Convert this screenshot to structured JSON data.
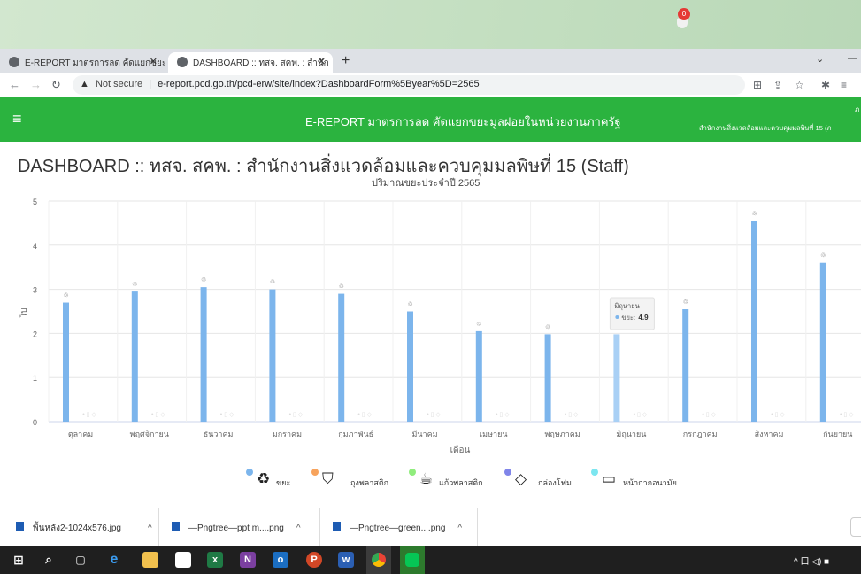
{
  "browser": {
    "tabs": [
      {
        "title": "E-REPORT มาตรการลด คัดแยกขยะมูล",
        "active": false
      },
      {
        "title": "DASHBOARD :: ทสจ. สคพ. : สำนัก",
        "active": true
      }
    ],
    "new_tab": "+",
    "security_label": "Not secure",
    "url": "e-report.pcd.go.th/pcd-erw/site/index?DashboardForm%5Byear%5D=2565"
  },
  "app": {
    "title": "E-REPORT มาตรการลด คัดแยกขยะมูลฝอยในหน่วยงานภาครัฐ",
    "notification_count": "0",
    "org_name": "สำนักงานสิ่งแวดล้อมและควบคุมมลพิษที่ 15 (ภ",
    "org_top": "ภ"
  },
  "page": {
    "title": "DASHBOARD :: ทสจ. สคพ. : สำนักงานสิ่งแวดล้อมและควบคุมมลพิษที่ 15 (Staff)"
  },
  "chart_data": {
    "type": "bar",
    "title": "ปริมาณขยะประจำปี 2565",
    "xlabel": "เดือน",
    "ylabel": "ใบ",
    "ylim": [
      0,
      5
    ],
    "yticks": [
      "0",
      "1",
      "2",
      "3",
      "4",
      "5"
    ],
    "categories": [
      "ตุลาคม",
      "พฤศจิกายน",
      "ธันวาคม",
      "มกราคม",
      "กุมภาพันธ์",
      "มีนาคม",
      "เมษายน",
      "พฤษภาคม",
      "มิถุนายน",
      "กรกฎาคม",
      "สิงหาคม",
      "กันยายน"
    ],
    "series": [
      {
        "name": "ขยะ",
        "color": "#7cb5ec",
        "values": [
          2.7,
          2.95,
          3.05,
          3.0,
          2.9,
          2.5,
          2.05,
          1.98,
          1.98,
          2.55,
          4.55,
          3.6
        ]
      },
      {
        "name": "ถุงพลาสติก",
        "color": "#f7a35c",
        "values": [
          0,
          0,
          0,
          0,
          0,
          0,
          0,
          0,
          0,
          0,
          0,
          0
        ]
      },
      {
        "name": "แก้วพลาสติก",
        "color": "#90ed7d",
        "values": [
          0,
          0,
          0,
          0,
          0,
          0,
          0,
          0,
          0,
          0,
          0,
          0
        ]
      },
      {
        "name": "กล่องโฟม",
        "color": "#8085e9",
        "values": [
          0,
          0,
          0,
          0,
          0,
          0,
          0,
          0,
          0,
          0,
          0,
          0
        ]
      },
      {
        "name": "หน้ากากอนามัย",
        "color": "#7ce6f0",
        "values": [
          0,
          0,
          0,
          0,
          0,
          0,
          0,
          0,
          0,
          0,
          0,
          0
        ]
      }
    ],
    "highlighted_category_index": 8,
    "tooltip": {
      "month": "มิถุนายน",
      "series": "ขยะ",
      "value": "4.9"
    },
    "legend_position": "bottom"
  },
  "downloads": [
    {
      "name": "พื้นหลัง2-1024x576.jpg"
    },
    {
      "name": "—Pngtree—ppt m....png"
    },
    {
      "name": "—Pngtree—green....png"
    }
  ],
  "taskbar": {
    "tray_text": "^ 口 ◁) ■"
  }
}
